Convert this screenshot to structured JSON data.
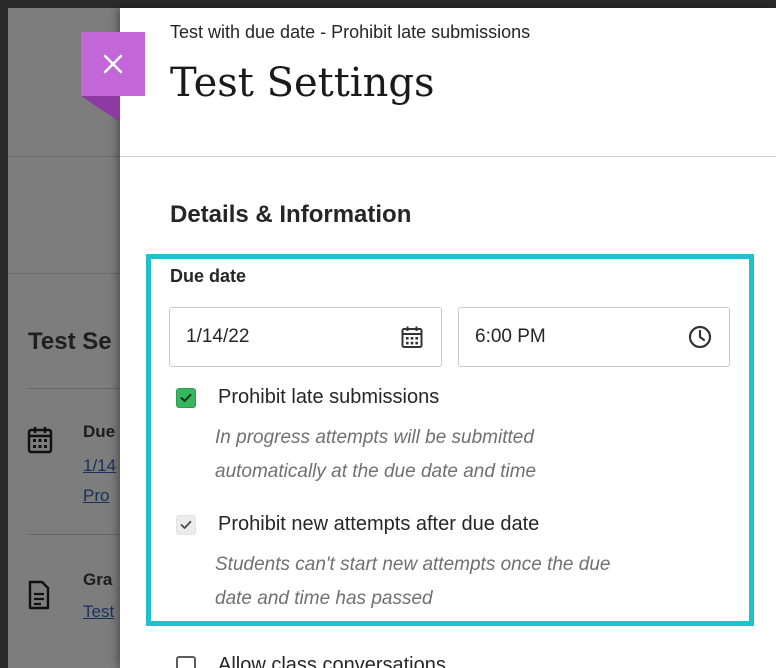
{
  "background": {
    "section_title": "Test Se",
    "items": [
      {
        "title": "Due",
        "line1": "1/14",
        "line2": "Pro",
        "icon": "calendar-icon"
      },
      {
        "title": "Gra",
        "line1": "Test",
        "icon": "document-icon"
      }
    ]
  },
  "panel": {
    "close_label": "×",
    "subtitle": "Test with due date - Prohibit late submissions",
    "title": "Test Settings",
    "section_heading": "Details & Information"
  },
  "due_date": {
    "label": "Due date",
    "date_value": "1/14/22",
    "time_value": "6:00 PM",
    "date_icon": "calendar-icon",
    "time_icon": "clock-icon"
  },
  "options": [
    {
      "label": "Prohibit late submissions",
      "checked": true,
      "helper_lines": [
        "In progress attempts will be submitted",
        "automatically at the due date and time"
      ]
    },
    {
      "label": "Prohibit new attempts after due date",
      "checked": true,
      "disabled": true,
      "helper_lines": [
        "Students can't start new attempts once the due",
        "date and time has passed"
      ]
    },
    {
      "label": "Allow class conversations",
      "checked": false
    }
  ],
  "colors": {
    "accent_close": "#c266d8",
    "highlight": "#1fc1cc",
    "checkbox_on": "#37b65f"
  }
}
